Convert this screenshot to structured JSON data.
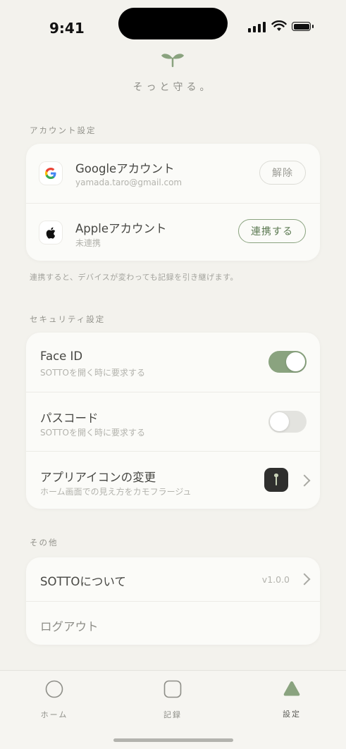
{
  "status_bar": {
    "time": "9:41"
  },
  "header": {
    "tagline": "そっと守る。"
  },
  "account": {
    "section_title": "アカウント設定",
    "google": {
      "icon": "google-g-icon",
      "title": "Googleアカウント",
      "subtitle": "yamada.taro@gmail.com",
      "button": "解除"
    },
    "apple": {
      "icon": "apple-logo-icon",
      "title": "Appleアカウント",
      "subtitle": "未連携",
      "button": "連携する"
    },
    "note": "連携すると、デバイスが変わっても記録を引き継げます。"
  },
  "security": {
    "section_title": "セキュリティ設定",
    "face_id": {
      "title": "Face ID",
      "subtitle": "SOTTOを開く時に要求する",
      "enabled": true
    },
    "passcode": {
      "title": "パスコード",
      "subtitle": "SOTTOを開く時に要求する",
      "enabled": false
    },
    "app_icon": {
      "title": "アプリアイコンの変更",
      "subtitle": "ホーム画面での見え方をカモフラージュ"
    }
  },
  "other": {
    "section_title": "その他",
    "about": {
      "title": "SOTTOについて",
      "version": "v1.0.0"
    },
    "logout": {
      "title": "ログアウト"
    }
  },
  "tabs": [
    {
      "label": "ホーム",
      "icon": "circle-icon",
      "active": false
    },
    {
      "label": "記録",
      "icon": "rounded-square-icon",
      "active": false
    },
    {
      "label": "設定",
      "icon": "triangle-icon",
      "active": true
    }
  ],
  "colors": {
    "accent": "#8aa37f",
    "background": "#f3f2ed",
    "card": "#fbfbf8"
  }
}
